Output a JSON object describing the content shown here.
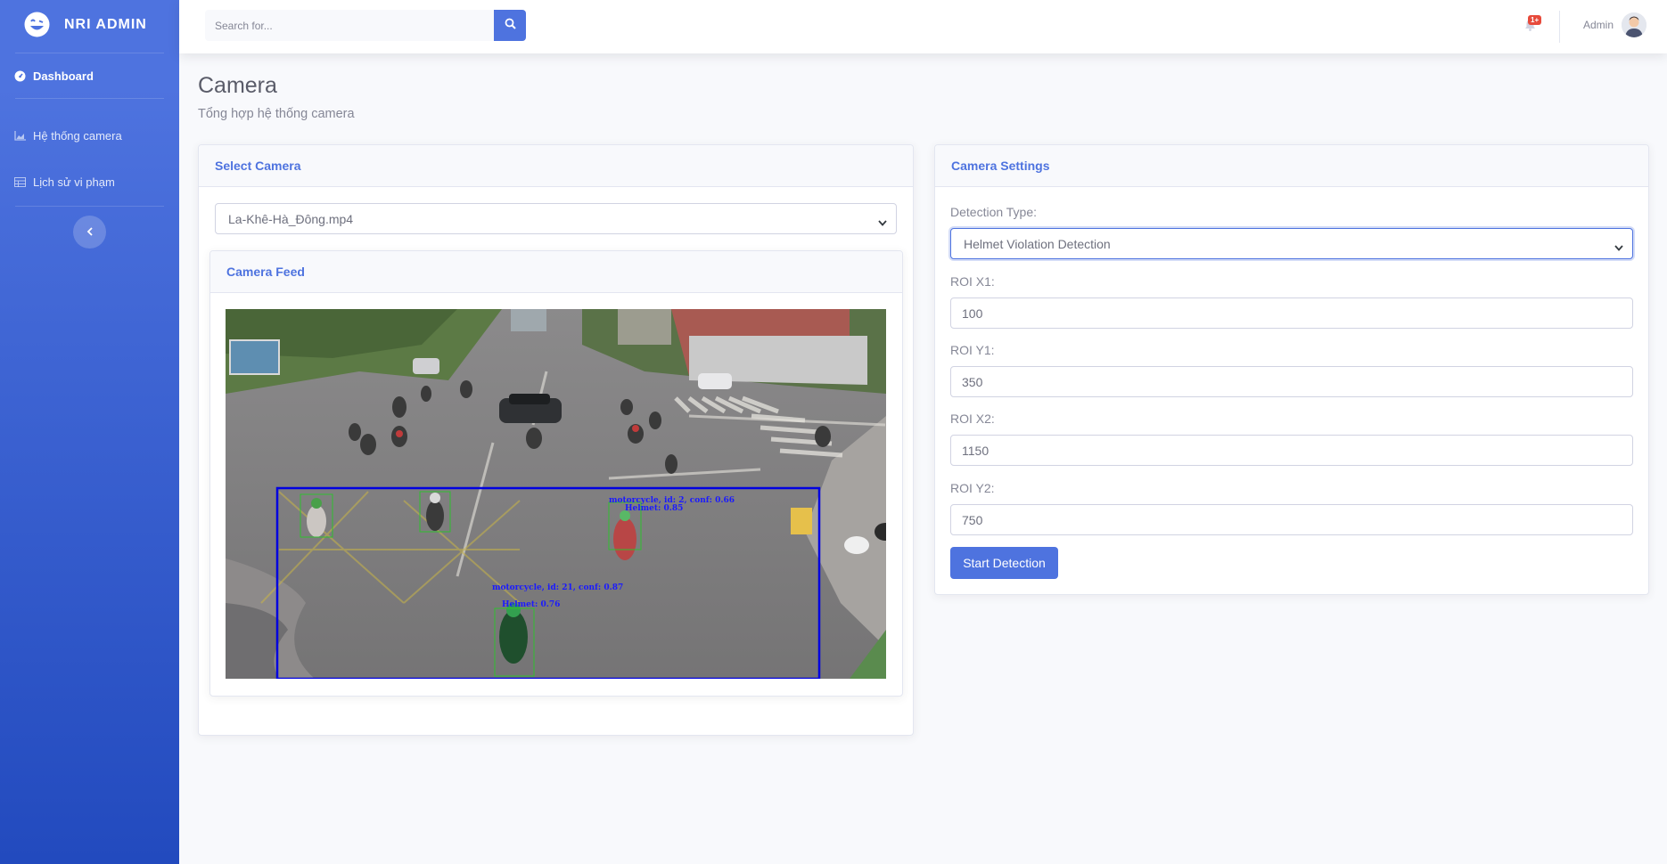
{
  "brand": {
    "name": "NRI ADMIN",
    "logo_icon": "laugh-wink-icon"
  },
  "sidebar": {
    "items": [
      {
        "label": "Dashboard",
        "icon": "tachometer-icon"
      },
      {
        "label": "Hệ thống camera",
        "icon": "chart-area-icon"
      },
      {
        "label": "Lịch sử vi phạm",
        "icon": "table-icon"
      }
    ],
    "toggle_icon": "chevron-left-icon"
  },
  "topbar": {
    "search": {
      "placeholder": "Search for...",
      "icon": "search-icon"
    },
    "alerts": {
      "badge": "1+",
      "icon": "bell-icon"
    },
    "user": {
      "name": "Admin"
    }
  },
  "page": {
    "title": "Camera",
    "subtitle": "Tổng hợp hệ thống camera"
  },
  "select_camera": {
    "title": "Select Camera",
    "value": "La-Khê-Hà_Đông.mp4",
    "feed_title": "Camera Feed"
  },
  "overlay": {
    "labels": [
      "motorcycle, id: 2, conf: 0.66",
      "Helmet: 0.85",
      "motorcycle, id: 21, conf: 0.87",
      "Helmet: 0.76"
    ]
  },
  "settings": {
    "title": "Camera Settings",
    "detection_label": "Detection Type:",
    "detection_value": "Helmet Violation Detection",
    "fields": [
      {
        "label": "ROI X1:",
        "value": "100"
      },
      {
        "label": "ROI Y1:",
        "value": "350"
      },
      {
        "label": "ROI X2:",
        "value": "1150"
      },
      {
        "label": "ROI Y2:",
        "value": "750"
      }
    ],
    "start_label": "Start Detection"
  },
  "colors": {
    "primary": "#4e73df",
    "badge": "#e74a3b"
  }
}
